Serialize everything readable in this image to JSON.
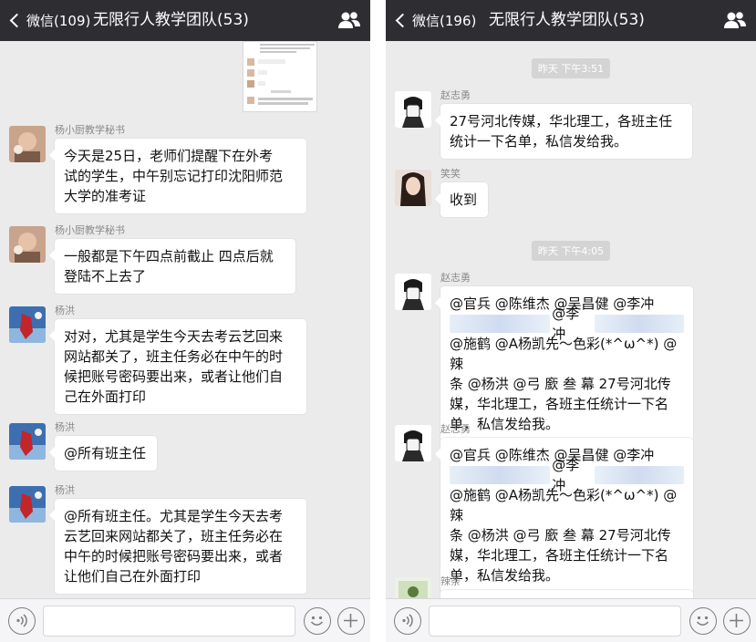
{
  "left": {
    "back_label": "微信(109)",
    "title": "无限行人教学团队(53)",
    "messages": [
      {
        "sender": "杨小厨教学秘书",
        "lines": [
          "今天是25日，老师们提醒下在外考",
          "试的学生，中午别忘记打印沈阳师范",
          "大学的准考证"
        ]
      },
      {
        "sender": "杨小厨教学秘书",
        "lines": [
          "一般都是下午四点前截止 四点后就",
          "登陆不上去了"
        ]
      },
      {
        "sender": "杨洪",
        "lines": [
          "对对，尤其是学生今天去考云艺回来",
          "网站都关了，班主任务必在中午的时",
          "候把账号密码要出来，或者让他们自",
          "己在外面打印"
        ]
      },
      {
        "sender": "杨洪",
        "lines": [
          "@所有班主任"
        ]
      },
      {
        "sender": "杨洪",
        "lines": [
          "@所有班主任。尤其是学生今天去考",
          "云艺回来网站都关了，班主任务必在",
          "中午的时候把账号密码要出来，或者",
          "让他们自己在外面打印"
        ]
      }
    ]
  },
  "right": {
    "back_label": "微信(196)",
    "title": "无限行人教学团队(53)",
    "timestamps": [
      "昨天 下午3:51",
      "昨天 下午4:05"
    ],
    "messages": [
      {
        "sender": "赵志勇",
        "lines": [
          "27号河北传媒，华北理工，各班主任",
          "统计一下名单，私信发给我。"
        ]
      },
      {
        "sender": "笑笑",
        "lines": [
          "收到"
        ]
      },
      {
        "sender": "赵志勇",
        "line1": "@官兵 @陈维杰 @吴昌健 @李冲",
        "blur_mention": "@李冲",
        "lines": [
          "@施鹤 @A杨凯先～色彩(*^ω^*) @辣",
          "条 @杨洪 @弓  廞  叁  幕 27号河北传",
          "媒，华北理工，各班主任统计一下名",
          "单，私信发给我。"
        ]
      },
      {
        "sender": "赵志勇",
        "line1": "@官兵 @陈维杰 @吴昌健 @李冲",
        "blur_mention": "@李冲",
        "lines": [
          "@施鹤 @A杨凯先～色彩(*^ω^*) @辣",
          "条 @杨洪 @弓  廞  叁  幕 27号河北传",
          "媒，华北理工，各班主任统计一下名",
          "单，私信发给我。"
        ]
      },
      {
        "sender": "辣条"
      }
    ]
  },
  "icons": {
    "back": "chevron-left-icon",
    "group": "group-members-icon",
    "voice": "voice-input-icon",
    "emoji": "emoji-icon",
    "plus": "plus-icon"
  },
  "colors": {
    "topbar": "#2e2d32",
    "chat_background": "#ebebeb",
    "bubble": "#ffffff",
    "timestamp_pill": "#d4d4d4"
  }
}
